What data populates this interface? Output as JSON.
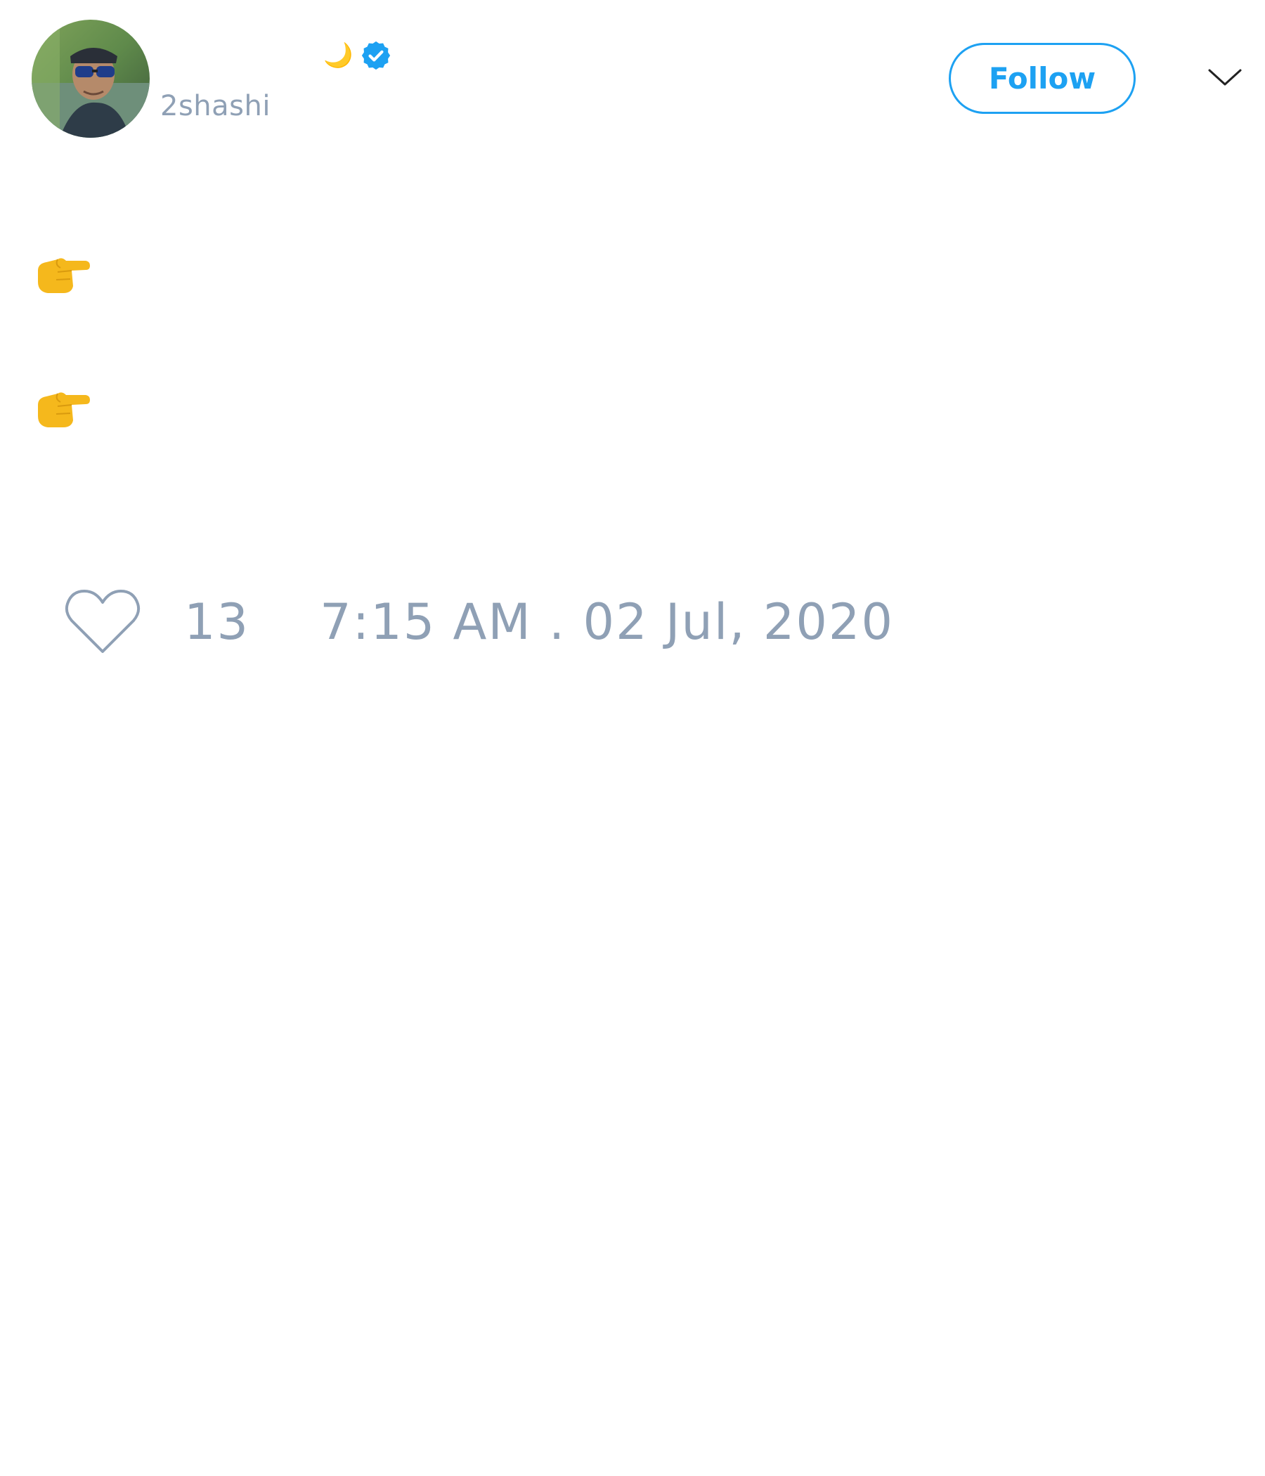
{
  "author": {
    "handle": "2shashi",
    "name_emoji": "🌙",
    "verified": true,
    "avatar_icon": "user-avatar-photo"
  },
  "header": {
    "follow_label": "Follow",
    "more_icon": "chevron-down-icon"
  },
  "tweet": {
    "lines": [
      {
        "icon": "pointing-hand-icon",
        "text": "👉"
      },
      {
        "icon": "pointing-hand-icon",
        "text": "👉"
      }
    ]
  },
  "footer": {
    "like_icon": "heart-icon",
    "like_count": "13",
    "timestamp": "7:15 AM . 02 Jul, 2020"
  },
  "colors": {
    "accent": "#1da1f2",
    "muted_text": "#8fa0b5",
    "emoji_yellow": "#f5b81c"
  }
}
